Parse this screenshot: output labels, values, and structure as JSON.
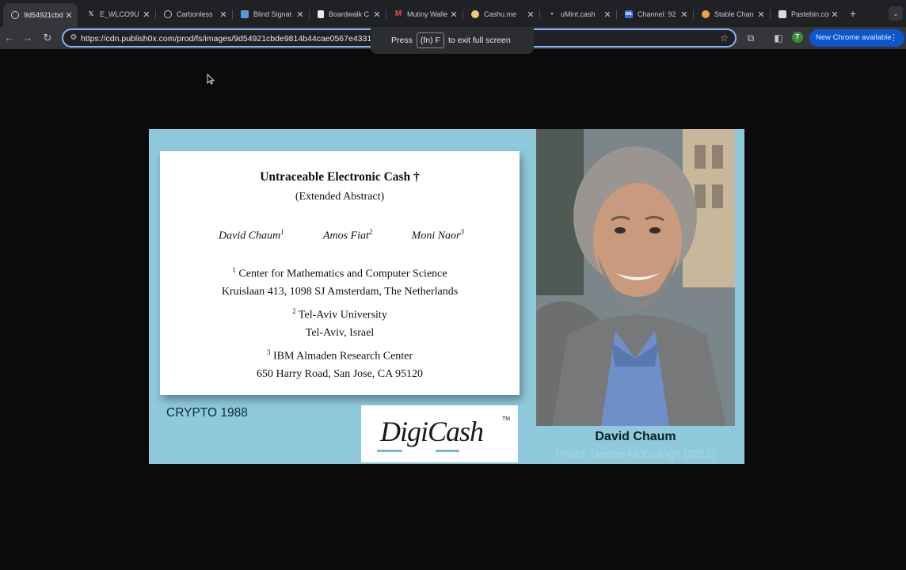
{
  "tabs": [
    {
      "title": "9d54921cbd",
      "icon": "globe-icon",
      "active": true
    },
    {
      "title": "E_WLCO9U",
      "icon": "x-logo-icon"
    },
    {
      "title": "Carbonless",
      "icon": "globe-icon"
    },
    {
      "title": "Blind Signat",
      "icon": "blue-grid-icon"
    },
    {
      "title": "Boardwalk C",
      "icon": "document-icon"
    },
    {
      "title": "Mutiny Walle",
      "icon": "mutiny-m-icon"
    },
    {
      "title": "Cashu.me",
      "icon": "hand-icon"
    },
    {
      "title": "uMint.cash",
      "icon": "dot-icon"
    },
    {
      "title": "Channel: 92",
      "icon": "1ml-icon"
    },
    {
      "title": "Stable Chan",
      "icon": "orange-coin-icon"
    },
    {
      "title": "Pastebin.cor",
      "icon": "pastebin-icon"
    }
  ],
  "toolbar": {
    "url": "https://cdn.publish0x.com/prod/fs/images/9d54921cbde9814b44cae0567e4331f7",
    "update_label": "New Chrome available",
    "profile_initial": "T"
  },
  "fullscreen_notice": {
    "press": "Press",
    "key": "(fn) F",
    "rest": "to exit full screen"
  },
  "slide": {
    "paper_title": "Untraceable Electronic Cash †",
    "paper_subtitle": "(Extended Abstract)",
    "authors": [
      {
        "name": "David Chaum",
        "sup": "1"
      },
      {
        "name": "Amos Fiat",
        "sup": "2"
      },
      {
        "name": "Moni Naor",
        "sup": "3"
      }
    ],
    "aff1_sup": "1",
    "aff1_line1": "Center for Mathematics and Computer Science",
    "aff1_line2": "Kruislaan 413, 1098 SJ Amsterdam, The Netherlands",
    "aff2_sup": "2",
    "aff2_line1": "Tel-Aviv University",
    "aff2_line2": "Tel-Aviv, Israel",
    "aff3_sup": "3",
    "aff3_line1": "IBM Almaden Research Center",
    "aff3_line2": "650 Harry Road, San Jose, CA 95120",
    "conference": "CRYPTO 1988",
    "logo_text": "DigiCash",
    "logo_tm": "TM",
    "person_name": "David Chaum",
    "photo_credit": "Photo: Declan McCullagh (2012)"
  },
  "colors": {
    "slide_background": "#8ec9dc",
    "omnibox_focus": "#8ab4f8",
    "update_button": "#0b57d0"
  }
}
